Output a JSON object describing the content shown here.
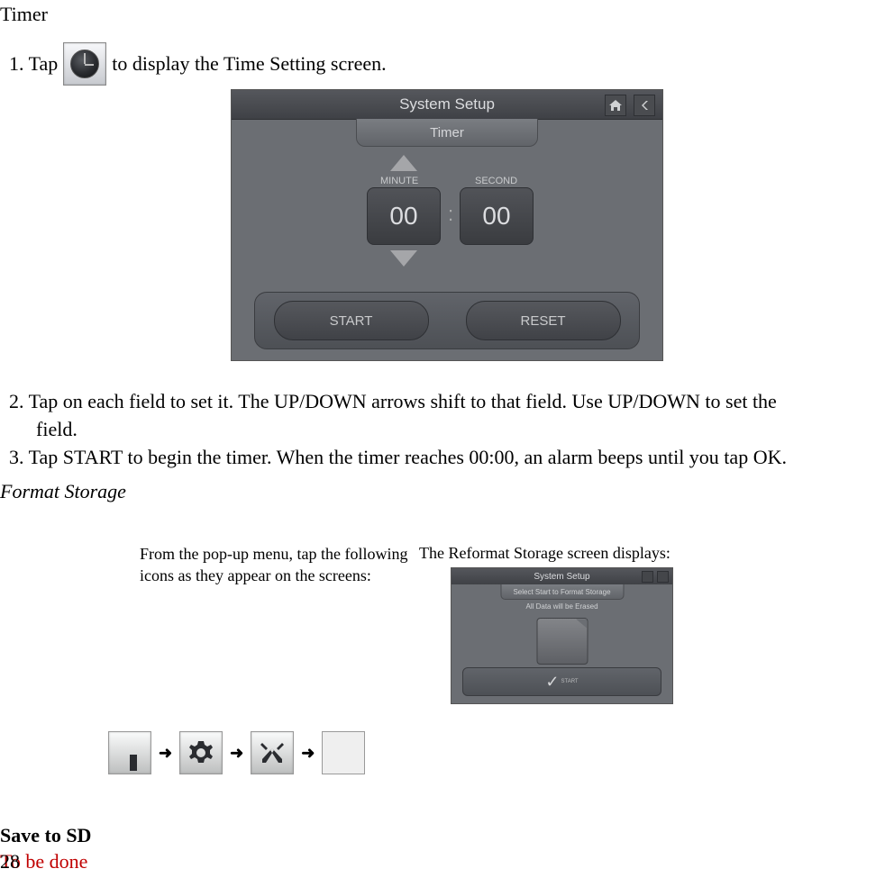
{
  "timer_heading": "Timer",
  "step1_pre": "1. Tap",
  "step1_post": "to display the Time Setting screen.",
  "screenshot1": {
    "header": "System Setup",
    "tab": "Timer",
    "minute_label": "MINUTE",
    "second_label": "SECOND",
    "minute_value": "00",
    "second_value": "00",
    "colon": ":",
    "start_btn": "START",
    "reset_btn": "RESET"
  },
  "step2_line1": "2. Tap on each field to set it. The UP/DOWN arrows shift to that field. Use UP/DOWN to set the",
  "step2_line2": "field.",
  "step3": "3. Tap START to begin the timer. When the timer reaches 00:00, an alarm beeps until you tap OK.",
  "format_heading": "Format Storage",
  "col1_text": "From the pop-up menu, tap the following icons as they appear on the screens:",
  "col2_text": "The Reformat Storage screen displays:",
  "arrow": "➜",
  "screenshot2": {
    "header": "System Setup",
    "tab": "Select Start to Format Storage",
    "sub": "All Data will be Erased",
    "start_label": "START"
  },
  "save_heading": "Save to SD",
  "to_be_done": "To be done",
  "page_num": "28"
}
